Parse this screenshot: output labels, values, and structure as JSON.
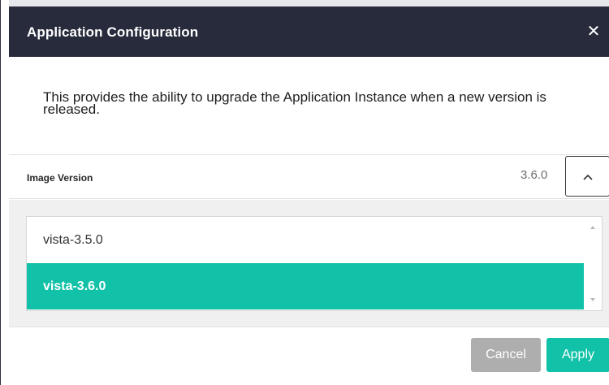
{
  "dialog": {
    "title": "Application Configuration",
    "close_label": "✕",
    "description": "This provides the ability to upgrade the Application Instance when a new version is released."
  },
  "image_version": {
    "label": "Image Version",
    "current_value": "3.6.0",
    "expanded": true,
    "options": [
      {
        "label": "vista-3.5.0",
        "selected": false
      },
      {
        "label": "vista-3.6.0",
        "selected": true
      }
    ]
  },
  "footer": {
    "cancel_label": "Cancel",
    "apply_label": "Apply"
  },
  "colors": {
    "header_bg": "#272b3c",
    "accent": "#12c2a8",
    "cancel_bg": "#aeaeae"
  },
  "icons": {
    "close": "close-icon",
    "toggle": "chevron-up-icon"
  }
}
